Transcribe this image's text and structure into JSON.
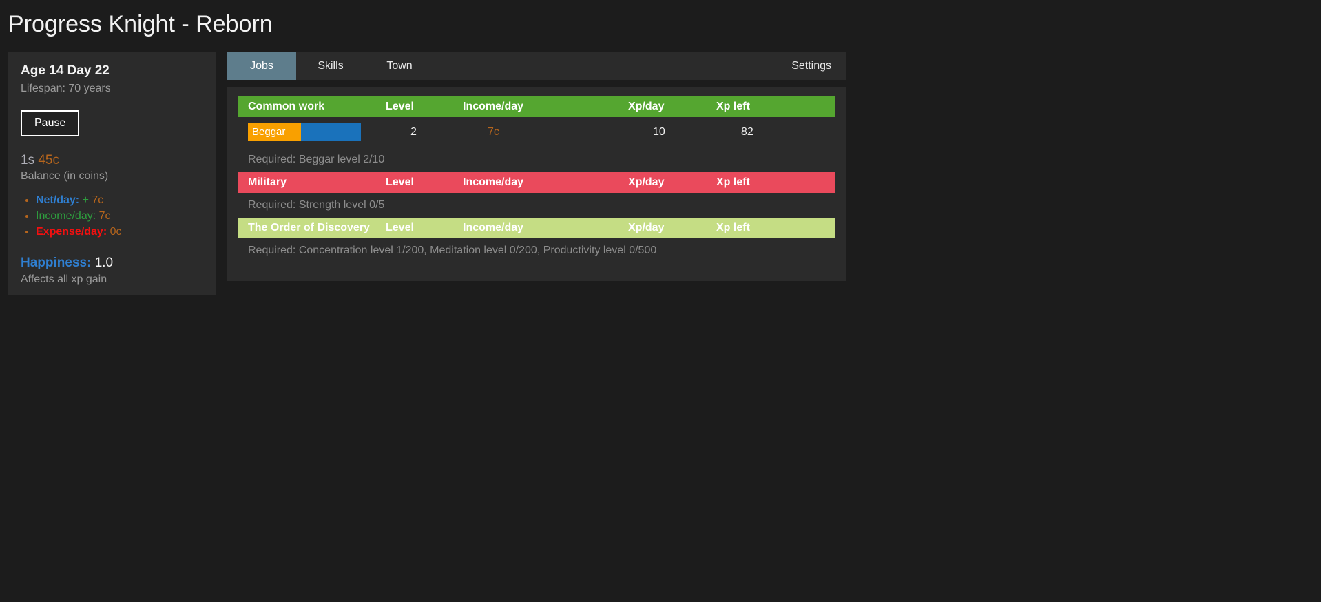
{
  "app": {
    "title": "Progress Knight - Reborn"
  },
  "sidebar": {
    "age_line": "Age 14 Day 22",
    "lifespan_line": "Lifespan: 70 years",
    "pause_label": "Pause",
    "balance": {
      "silver": "1s",
      "copper": "45c",
      "label": "Balance (in coins)"
    },
    "stats": {
      "net_label": "Net/day:",
      "net_sign": "+",
      "net_value": "7c",
      "income_label": "Income/day:",
      "income_value": "7c",
      "expense_label": "Expense/day:",
      "expense_value": "0c"
    },
    "happiness": {
      "label": "Happiness:",
      "value": "1.0",
      "sub": "Affects all xp gain"
    }
  },
  "tabs": {
    "jobs": "Jobs",
    "skills": "Skills",
    "town": "Town",
    "settings": "Settings"
  },
  "jobs": {
    "columns": {
      "level": "Level",
      "income": "Income/day",
      "xpday": "Xp/day",
      "xpleft": "Xp left"
    },
    "categories": [
      {
        "name": "Common work",
        "color": "#55a630",
        "requirement": "Required: Beggar level 2/10",
        "row": {
          "job_name": "Beggar",
          "progress_percent": 47,
          "level": "2",
          "income": "7c",
          "xp_day": "10",
          "xp_left": "82"
        }
      },
      {
        "name": "Military",
        "color": "#ea4a5c",
        "requirement": "Required: Strength level 0/5"
      },
      {
        "name": "The Order of Discovery",
        "color": "#c5dd84",
        "requirement": "Required: Concentration level 1/200, Meditation level 0/200, Productivity level 0/500"
      }
    ]
  }
}
